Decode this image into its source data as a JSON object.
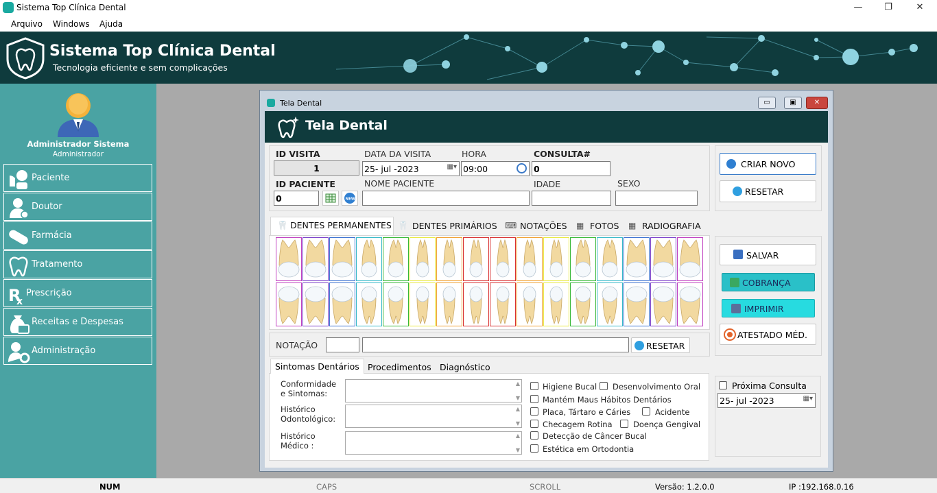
{
  "app": {
    "title": "Sistema Top Clínica Dental",
    "window_controls": [
      "—",
      "❐",
      "✕"
    ]
  },
  "menu": [
    "Arquivo",
    "Windows",
    "Ajuda"
  ],
  "banner": {
    "title": "Sistema Top Clínica Dental",
    "subtitle": "Tecnologia eficiente e sem complicações"
  },
  "sidebar": {
    "user_name": "Administrador Sistema",
    "user_role": "Administrador",
    "items": [
      {
        "label": "Paciente",
        "icon": "patient-icon"
      },
      {
        "label": "Doutor",
        "icon": "doctor-icon"
      },
      {
        "label": "Farmácia",
        "icon": "pill-icon"
      },
      {
        "label": "Tratamento",
        "icon": "tooth-icon"
      },
      {
        "label": "Prescrição",
        "icon": "rx-icon"
      },
      {
        "label": "Receitas e Despesas",
        "icon": "money-bag-icon"
      },
      {
        "label": "Administração",
        "icon": "admin-icon"
      }
    ]
  },
  "window": {
    "title": "Tela Dental",
    "header": "Tela Dental",
    "controls": [
      "▭",
      "▣",
      "✕"
    ]
  },
  "visit": {
    "id_visita_label": "ID VISITA",
    "id_visita_value": "1",
    "data_label": "DATA DA VISITA",
    "data_value": "25- jul -2023",
    "hora_label": "HORA",
    "hora_value": "09:00",
    "consulta_label": "CONSULTA#",
    "consulta_value": "0",
    "id_paciente_label": "ID PACIENTE",
    "id_paciente_value": "0",
    "nome_label": "NOME PACIENTE",
    "nome_value": "",
    "idade_label": "IDADE",
    "idade_value": "",
    "sexo_label": "SEXO",
    "sexo_value": ""
  },
  "actions": {
    "criar_novo": "CRIAR NOVO",
    "resetar": "RESETAR",
    "salvar": "SALVAR",
    "cobranca": "COBRANÇA",
    "imprimir": "IMPRIMIR",
    "atestado": "ATESTADO MÉD."
  },
  "tabs": [
    {
      "label": "DENTES PERMANENTES",
      "active": true
    },
    {
      "label": "DENTES PRIMÁRIOS",
      "active": false
    },
    {
      "label": "NOTAÇÕES",
      "active": false
    },
    {
      "label": "FOTOS",
      "active": false
    },
    {
      "label": "RADIOGRAFIA",
      "active": false
    }
  ],
  "teeth": {
    "upper_border_colors": [
      "#c040c0",
      "#7a3fc9",
      "#3a70d0",
      "#36b8c8",
      "#38b838",
      "#e8e840",
      "#f0a030",
      "#d83030",
      "#d83030",
      "#f0a030",
      "#e8e840",
      "#38b838",
      "#36b8c8",
      "#3a70d0",
      "#7a3fc9",
      "#c040c0"
    ],
    "lower_border_colors": [
      "#c040c0",
      "#7a3fc9",
      "#3a70d0",
      "#36b8c8",
      "#38b838",
      "#e8e840",
      "#f0a030",
      "#d83030",
      "#d83030",
      "#f0a030",
      "#e8e840",
      "#38b838",
      "#36b8c8",
      "#3a70d0",
      "#7a3fc9",
      "#c040c0"
    ]
  },
  "notacao": {
    "label": "NOTAÇÃO",
    "code_value": "",
    "text_value": "",
    "reset_label": "RESETAR"
  },
  "bottom_tabs": [
    {
      "label": "Sintomas Dentários",
      "active": true
    },
    {
      "label": "Procedimentos",
      "active": false
    },
    {
      "label": "Diagnóstico",
      "active": false
    }
  ],
  "history_fields": [
    {
      "label_line1": "Conformidade",
      "label_line2": "e Sintomas:"
    },
    {
      "label_line1": "Histórico",
      "label_line2": "Odontológico:"
    },
    {
      "label_line1": "Histórico",
      "label_line2": "Médico :"
    }
  ],
  "checkboxes": {
    "higiene": "Higiene Bucal",
    "desenvolvimento": "Desenvolvimento Oral",
    "maus_habitos": "Mantém Maus Hábitos Dentários",
    "placa": "Placa, Tártaro e Cáries",
    "acidente": "Acidente",
    "checagem": "Checagem Rotina",
    "gengival": "Doença Gengival",
    "cancer": "Detecção de Câncer Bucal",
    "estetica": "Estética em Ortodontia"
  },
  "proxima": {
    "label": "Próxima Consulta",
    "date_value": "25- jul -2023"
  },
  "status": {
    "num": "NUM",
    "caps": "CAPS",
    "scroll": "SCROLL",
    "version": "Versão: 1.2.0.0",
    "ip": "IP :192.168.0.16"
  }
}
